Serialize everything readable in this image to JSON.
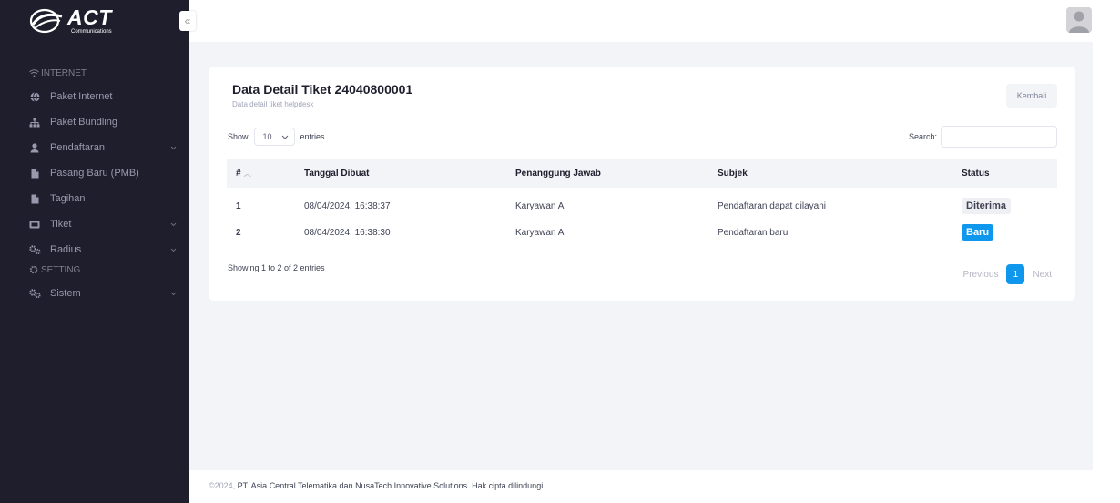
{
  "brand": {
    "name": "ACT",
    "subtitle": "Communications"
  },
  "sidebar": {
    "collapse_glyph": "«",
    "sections": [
      {
        "title": "INTERNET",
        "icon": "wifi-icon",
        "items": [
          {
            "label": "Paket Internet",
            "icon": "globe-icon",
            "has_submenu": false
          },
          {
            "label": "Paket Bundling",
            "icon": "sitemap-icon",
            "has_submenu": false
          },
          {
            "label": "Pendaftaran",
            "icon": "user-icon",
            "has_submenu": true
          },
          {
            "label": "Pasang Baru (PMB)",
            "icon": "file-icon",
            "has_submenu": false
          },
          {
            "label": "Tagihan",
            "icon": "file-icon",
            "has_submenu": false
          },
          {
            "label": "Tiket",
            "icon": "ticket-icon",
            "has_submenu": true
          },
          {
            "label": "Radius",
            "icon": "cogs-icon",
            "has_submenu": true
          }
        ]
      },
      {
        "title": "SETTING",
        "icon": "gear-icon",
        "items": [
          {
            "label": "Sistem",
            "icon": "cogs-icon",
            "has_submenu": true
          }
        ]
      }
    ]
  },
  "card": {
    "title": "Data Detail Tiket 24040800001",
    "subtitle": "Data detail tiket helpdesk",
    "back_label": "Kembali",
    "show_label": "Show",
    "entries_label": "entries",
    "page_length": "10",
    "search_label": "Search:",
    "search_value": "",
    "columns": [
      "#",
      "Tanggal Dibuat",
      "Penanggung Jawab",
      "Subjek",
      "Status"
    ],
    "rows": [
      {
        "no": "1",
        "tanggal": "08/04/2024, 16:38:37",
        "pj": "Karyawan A",
        "subjek": "Pendaftaran dapat dilayani",
        "status": "Diterima",
        "status_style": "light"
      },
      {
        "no": "2",
        "tanggal": "08/04/2024, 16:38:30",
        "pj": "Karyawan A",
        "subjek": "Pendaftaran baru",
        "status": "Baru",
        "status_style": "primary"
      }
    ],
    "info": "Showing 1 to 2 of 2 entries",
    "pagination": {
      "previous": "Previous",
      "current": "1",
      "next": "Next"
    }
  },
  "footer": {
    "year": "©2024,",
    "text": "PT. Asia Central Telematika dan NusaTech Innovative Solutions. Hak cipta dilindungi."
  },
  "colors": {
    "sidebar_bg": "#1e1e2d",
    "content_bg": "#f3f4f8",
    "primary": "#0f97ee"
  }
}
